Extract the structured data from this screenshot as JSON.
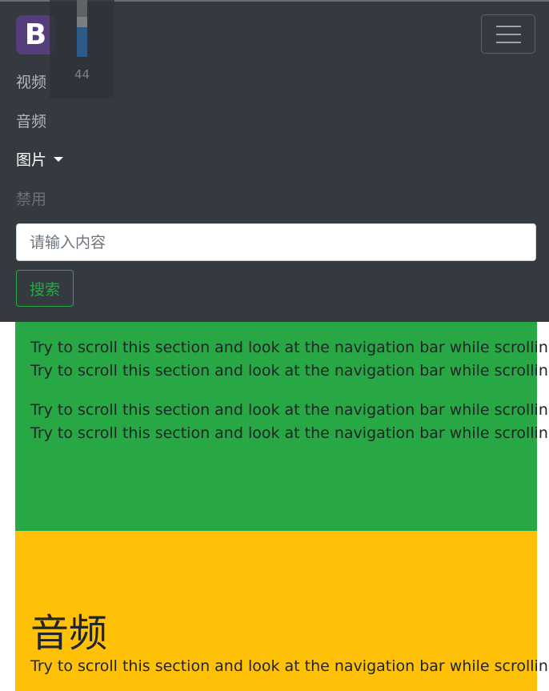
{
  "navbar": {
    "brand_letter": "B",
    "links": {
      "video": "视频",
      "audio": "音频",
      "images": "图片",
      "disabled": "禁用"
    },
    "search": {
      "placeholder": "请输入内容",
      "value": "",
      "button_label": "搜索"
    },
    "colors": {
      "background": "#343a40",
      "brand": "#563d7c",
      "search_button": "#28a745"
    }
  },
  "scroll_indicator": {
    "value": "44"
  },
  "sections": {
    "green": {
      "color": "#28a745",
      "paragraphs": [
        "Try to scroll this section and look at the navigation bar while scrolling!",
        "Try to scroll this section and look at the navigation bar while scrolling!",
        "Try to scroll this section and look at the navigation bar while scrolling!",
        "Try to scroll this section and look at the navigation bar while scrolling!"
      ]
    },
    "yellow": {
      "color": "#ffc107",
      "title": "音频",
      "paragraphs": [
        "Try to scroll this section and look at the navigation bar while scrolling!"
      ]
    }
  }
}
